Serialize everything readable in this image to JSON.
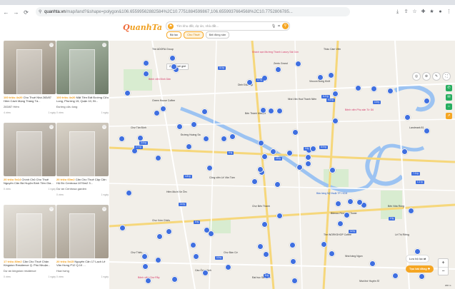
{
  "browser": {
    "url_host": "quanhta.vn",
    "url_path": "/map/land?&shape=polygon&106.65599562882584%2C10.7751884599867,106.6559937664568%2C10.7752806785...",
    "nav": {
      "back": "←",
      "forward": "→",
      "reload": "⟳",
      "lock": "⚲"
    },
    "icons": [
      "download-icon",
      "share-icon",
      "star-icon",
      "extension-icon",
      "bookmark-icon",
      "profile-icon",
      "menu-icon"
    ]
  },
  "header": {
    "logo_text": "uanhTa",
    "logo_prefix": "Q",
    "search_placeholder": "Tìm khu đất, dự án, nhà đất...",
    "pills": [
      {
        "label": "Bộ lọc"
      },
      {
        "label": "Cho Thuê"
      },
      {
        "label": "Bất động sản"
      }
    ]
  },
  "listings": [
    {
      "price": "100 triệu",
      "area": "4x20",
      "title": "Cho Thuê Nhà 283/87 Hẻm Cách Mạng Tháng Tá...",
      "price_line": "283/87 Hẻm",
      "views": "4 view",
      "meta": "1 ngày"
    },
    {
      "price": "100 triệu",
      "area": "4x20",
      "title": "Mặt Tiền Đất Đường Cửu Long, Phường 15, Quận 10, Đi...",
      "price_line": "Đường cửu long",
      "views": "0 view",
      "meta": "1 ngày"
    },
    {
      "price": "20 triệu",
      "area": "5x14",
      "title": "Chính Chủ Cho Thuê Nguyên Căn Bà Huyện Bình Tiền Gia...",
      "price_line": "",
      "views": "0 view",
      "meta": "1 ngày"
    },
    {
      "price": "20 triệu",
      "area": "60m2",
      "title": "Căn Cho Thuê Cặp Căn Hộ Đồ Centrosa 1076m2 3...",
      "price_line": "Dự án Centrosa garden",
      "views": "0 view",
      "meta": "1 ngày"
    },
    {
      "price": "17 triệu",
      "area": "80m2",
      "title": "Căn Cho Thuê Chân Kingston Residence Q. Phú Nhuận...",
      "price_line": "Dự án kingston residence",
      "views": "0 view",
      "meta": "1 ngày"
    },
    {
      "price": "20 triệu",
      "area": "5x15",
      "title": "Nguyên Căn 17 Lạch Lê Văn Hưng P12 Q.10 ...",
      "price_line": "Hoà hưng",
      "views": "0 view",
      "meta": "1 ngày"
    }
  ],
  "map": {
    "dropdown": "2020 mới giới",
    "labels": [
      {
        "text": "The ADORA Group",
        "cls": ""
      },
      {
        "text": "Khách sạn Mường Thanh Luxury Sài Gòn",
        "cls": "red"
      },
      {
        "text": "Bệnh viện Bình Dân",
        "cls": "red"
      },
      {
        "text": "Zento Grand",
        "cls": ""
      },
      {
        "text": "Dinh Độc Lập",
        "cls": ""
      },
      {
        "text": "Bến Thành Market",
        "cls": ""
      },
      {
        "text": "Green House Coffee",
        "cls": ""
      },
      {
        "text": "Đường Hoàng Sa",
        "cls": ""
      },
      {
        "text": "Chợ Tân Định",
        "cls": ""
      },
      {
        "text": "Bệnh viện Phụ sản Từ Dũ",
        "cls": "red"
      },
      {
        "text": "Nhà Văn Hoá Thanh Niên",
        "cls": ""
      },
      {
        "text": "Thảo Cầm Viên",
        "cls": ""
      },
      {
        "text": "Landmark 81",
        "cls": ""
      },
      {
        "text": "Vincom Đồng Khởi",
        "cls": ""
      },
      {
        "text": "Công viên Lê Văn Tám",
        "cls": ""
      },
      {
        "text": "Hẻm Mười Xe Ôm",
        "cls": ""
      },
      {
        "text": "Chợ Thiếc",
        "cls": ""
      },
      {
        "text": "Nhà hàng Ngon",
        "cls": ""
      },
      {
        "text": "The WORKSHOP Coffee",
        "cls": ""
      },
      {
        "text": "Bảo tàng Mỹ thuật TP. HCM",
        "cls": "blue"
      },
      {
        "text": "Chợ Bến Thành",
        "cls": ""
      },
      {
        "text": "Bitexco Financial Tower",
        "cls": ""
      },
      {
        "text": "Bến Nhà Rồng",
        "cls": ""
      },
      {
        "text": "Cầu Ông Lãnh",
        "cls": ""
      },
      {
        "text": "Đại học Sài Gòn",
        "cls": ""
      },
      {
        "text": "Chợ Xóm Chiếu",
        "cls": ""
      },
      {
        "text": "Nhà thờ Huyện Sĩ",
        "cls": ""
      },
      {
        "text": "Chợ Bàn Cờ",
        "cls": ""
      },
      {
        "text": "Bệnh viện Chợ Rẫy",
        "cls": "red"
      },
      {
        "text": "Lê Thị Riêng",
        "cls": ""
      }
    ],
    "pins": [
      "1",
      "2",
      "3",
      "4",
      "5",
      "6",
      "7",
      "8",
      "9",
      "10",
      "11",
      "12",
      "13",
      "14",
      "15",
      "16",
      "17",
      "18",
      "19",
      "20",
      "21",
      "22",
      "23",
      "24",
      "25",
      "26",
      "27",
      "28",
      "29",
      "30",
      "31",
      "32",
      "33",
      "34",
      "35",
      "36",
      "37",
      "38",
      "39",
      "40",
      "41",
      "42",
      "43",
      "44",
      "45",
      "46",
      "47",
      "48",
      "49",
      "50",
      "51",
      "52",
      "53",
      "54",
      "55",
      "56",
      "57",
      "58",
      "59",
      "60",
      "61",
      "62",
      "63",
      "64",
      "65",
      "66",
      "67",
      "68",
      "69",
      "70",
      "71",
      "72",
      "73",
      "74",
      "75",
      "76",
      "77",
      "78",
      "79",
      "80",
      "81",
      "82",
      "83",
      "84",
      "85",
      "86",
      "87",
      "88",
      "89",
      "90"
    ],
    "price_tags": [
      "17 tỷ",
      "1.1 tỷ",
      "5.9 tỷ",
      "12 tỷ",
      "15 tỷ",
      "2 tỷ",
      "3.5 tỷ",
      "8 tỷ",
      "6.2 tỷ",
      "9.5 tỷ",
      "4.8 tỷ",
      "11 tỷ",
      "7.3 tỷ",
      "2.7 tỷ",
      "14 tỷ",
      "5 tỷ",
      "10 tỷ",
      "3 tỷ",
      "13 tỷ",
      "6 tỷ"
    ],
    "save_label": "Lưu bộ lọc",
    "create_label": "Tạo bài đăng",
    "scale_label": "200 m"
  }
}
